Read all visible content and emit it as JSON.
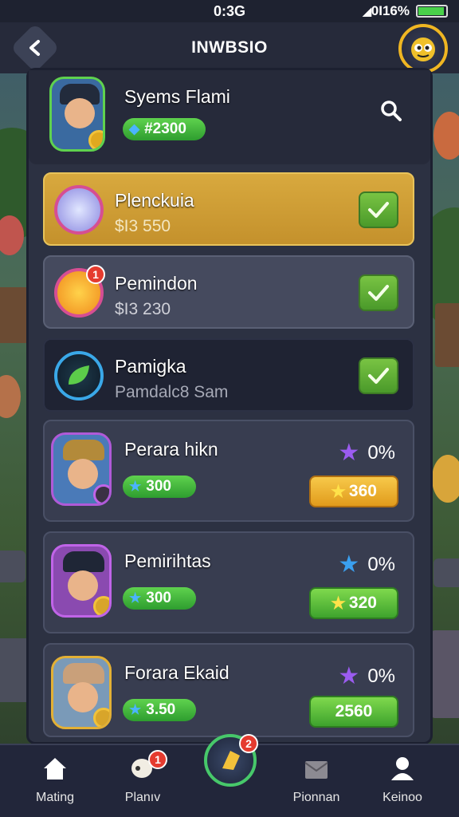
{
  "status_bar": {
    "time": "0:3G",
    "signal": "◢",
    "battery_pct": "0I16%",
    "battery_level": 0.95
  },
  "header": {
    "title": "INWBSIO",
    "back_icon": "chevron-left-icon",
    "mascot_icon": "mascot-icon"
  },
  "profile": {
    "name": "Syems Flami",
    "gems": "2300",
    "gem_prefix": "#",
    "search_icon": "search-icon"
  },
  "rows": [
    {
      "title": "Plenckuia",
      "subtitle": "$I3 550",
      "icon": "bunny-icon",
      "checked": true,
      "highlighted": true
    },
    {
      "title": "Pemindon",
      "subtitle": "$I3 230",
      "icon": "fox-icon",
      "checked": true,
      "notification": "1"
    },
    {
      "title": "Pamigka",
      "subtitle": "Pamdalc8 Sam",
      "icon": "leaf-icon",
      "checked": true
    }
  ],
  "players": [
    {
      "name": "Perara hikn",
      "gems": "300",
      "percent": "0%",
      "star_color": "#9b5cf0",
      "reward": "360",
      "reward_style": "yellow"
    },
    {
      "name": "Pemirihtas",
      "gems": "300",
      "percent": "0%",
      "star_color": "#3aa0f0",
      "reward": "320",
      "reward_style": "green"
    },
    {
      "name": "Forara Ekaid",
      "gems": "3.50",
      "percent": "0%",
      "star_color": "#9b5cf0",
      "reward": "2560",
      "reward_style": "green"
    }
  ],
  "nav": {
    "items": [
      {
        "label": "Mating",
        "icon": "home-icon"
      },
      {
        "label": "Planıv",
        "icon": "chat-icon",
        "badge": "1"
      },
      {
        "label": "",
        "icon": "shield-icon",
        "badge": "2"
      },
      {
        "label": "Pionnan",
        "icon": "mail-icon"
      },
      {
        "label": "Keinoo",
        "icon": "profile-icon"
      }
    ]
  },
  "colors": {
    "accent": "#f0b622",
    "check": "#5aab34",
    "highlight": "#d6a43a"
  }
}
